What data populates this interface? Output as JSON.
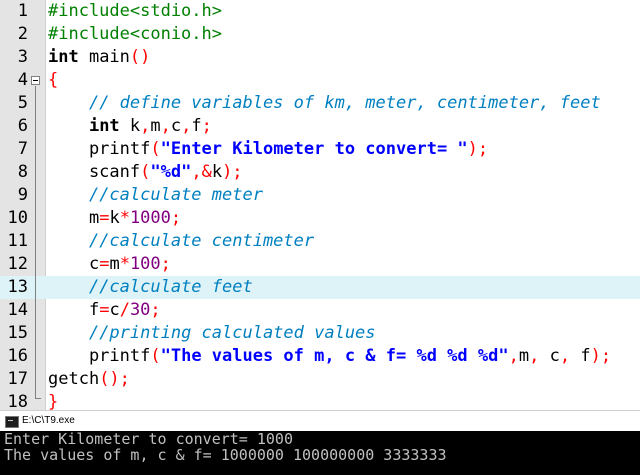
{
  "editor": {
    "current_line": 13,
    "lines": [
      {
        "n": "1",
        "tokens": [
          [
            "pp",
            "#include<stdio.h>"
          ]
        ]
      },
      {
        "n": "2",
        "tokens": [
          [
            "pp",
            "#include<conio.h>"
          ]
        ]
      },
      {
        "n": "3",
        "tokens": [
          [
            "kw",
            "int"
          ],
          [
            "tx",
            " main"
          ],
          [
            "br",
            "()"
          ]
        ]
      },
      {
        "n": "4",
        "tokens": [
          [
            "br",
            "{"
          ]
        ]
      },
      {
        "n": "5",
        "tokens": [
          [
            "tx",
            "    "
          ],
          [
            "cm",
            "// define variables of km, meter, centimeter, feet"
          ]
        ]
      },
      {
        "n": "6",
        "tokens": [
          [
            "tx",
            "    "
          ],
          [
            "kw",
            "int"
          ],
          [
            "tx",
            " k"
          ],
          [
            "op",
            ","
          ],
          [
            "tx",
            "m"
          ],
          [
            "op",
            ","
          ],
          [
            "tx",
            "c"
          ],
          [
            "op",
            ","
          ],
          [
            "tx",
            "f"
          ],
          [
            "op",
            ";"
          ]
        ]
      },
      {
        "n": "7",
        "tokens": [
          [
            "tx",
            "    printf"
          ],
          [
            "br",
            "("
          ],
          [
            "st",
            "\"Enter Kilometer to convert= \""
          ],
          [
            "br",
            ");"
          ]
        ]
      },
      {
        "n": "8",
        "tokens": [
          [
            "tx",
            "    scanf"
          ],
          [
            "br",
            "("
          ],
          [
            "st",
            "\"%d\""
          ],
          [
            "op",
            ",&"
          ],
          [
            "tx",
            "k"
          ],
          [
            "br",
            ");"
          ]
        ]
      },
      {
        "n": "9",
        "tokens": [
          [
            "tx",
            "    "
          ],
          [
            "cm",
            "//calculate meter"
          ]
        ]
      },
      {
        "n": "10",
        "tokens": [
          [
            "tx",
            "    m"
          ],
          [
            "op",
            "="
          ],
          [
            "tx",
            "k"
          ],
          [
            "op",
            "*"
          ],
          [
            "nm",
            "1000"
          ],
          [
            "op",
            ";"
          ]
        ]
      },
      {
        "n": "11",
        "tokens": [
          [
            "tx",
            "    "
          ],
          [
            "cm",
            "//calculate centimeter"
          ]
        ]
      },
      {
        "n": "12",
        "tokens": [
          [
            "tx",
            "    c"
          ],
          [
            "op",
            "="
          ],
          [
            "tx",
            "m"
          ],
          [
            "op",
            "*"
          ],
          [
            "nm",
            "100"
          ],
          [
            "op",
            ";"
          ]
        ]
      },
      {
        "n": "13",
        "tokens": [
          [
            "tx",
            "    "
          ],
          [
            "cm",
            "//calculate feet"
          ]
        ]
      },
      {
        "n": "14",
        "tokens": [
          [
            "tx",
            "    f"
          ],
          [
            "op",
            "="
          ],
          [
            "tx",
            "c"
          ],
          [
            "op",
            "/"
          ],
          [
            "nm",
            "30"
          ],
          [
            "op",
            ";"
          ]
        ]
      },
      {
        "n": "15",
        "tokens": [
          [
            "tx",
            "    "
          ],
          [
            "cm",
            "//printing calculated values"
          ]
        ]
      },
      {
        "n": "16",
        "tokens": [
          [
            "tx",
            "    printf"
          ],
          [
            "br",
            "("
          ],
          [
            "st",
            "\"The values of m, c & f= %d %d %d\""
          ],
          [
            "op",
            ","
          ],
          [
            "tx",
            "m"
          ],
          [
            "op",
            ","
          ],
          [
            "tx",
            " c"
          ],
          [
            "op",
            ","
          ],
          [
            "tx",
            " f"
          ],
          [
            "br",
            ");"
          ]
        ]
      },
      {
        "n": "17",
        "tokens": [
          [
            "tx",
            "getch"
          ],
          [
            "br",
            "()"
          ],
          [
            "op",
            ";"
          ]
        ]
      },
      {
        "n": "18",
        "tokens": [
          [
            "br",
            "}"
          ]
        ]
      }
    ]
  },
  "console": {
    "title": "E:\\C\\T9.exe",
    "output": [
      "Enter Kilometer to convert= 1000",
      "The values of m, c & f= 1000000 100000000 3333333"
    ]
  }
}
